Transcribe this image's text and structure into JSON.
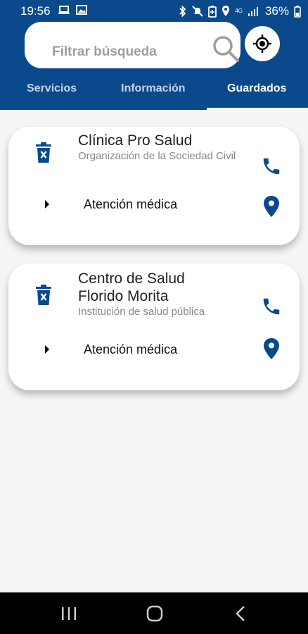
{
  "status_bar": {
    "time": "19:56",
    "battery": "36%",
    "network": "4G"
  },
  "search": {
    "placeholder": "Filtrar búsqueda"
  },
  "tabs": [
    {
      "label": "Servicios",
      "active": false
    },
    {
      "label": "Información",
      "active": false
    },
    {
      "label": "Guardados",
      "active": true
    }
  ],
  "saved": [
    {
      "name": "Clínica Pro Salud",
      "organization": "Organización de la Sociedad Civil",
      "service": "Atención médica"
    },
    {
      "name": "Centro de Salud Florido Morita",
      "organization": "Institución de salud pública",
      "service": "Atención médica"
    }
  ],
  "colors": {
    "primary": "#0a4a8c",
    "icon": "#0a4a8c",
    "background": "#f5f5f5"
  },
  "icons": [
    "laptop-icon",
    "image-icon",
    "bluetooth-icon",
    "mute-icon",
    "battery-saver-icon",
    "location-icon",
    "signal-icon",
    "search-icon",
    "my-location-icon",
    "trash-icon",
    "phone-icon",
    "arrow-right-icon",
    "map-pin-icon",
    "recent-apps-icon",
    "home-icon",
    "back-icon"
  ]
}
